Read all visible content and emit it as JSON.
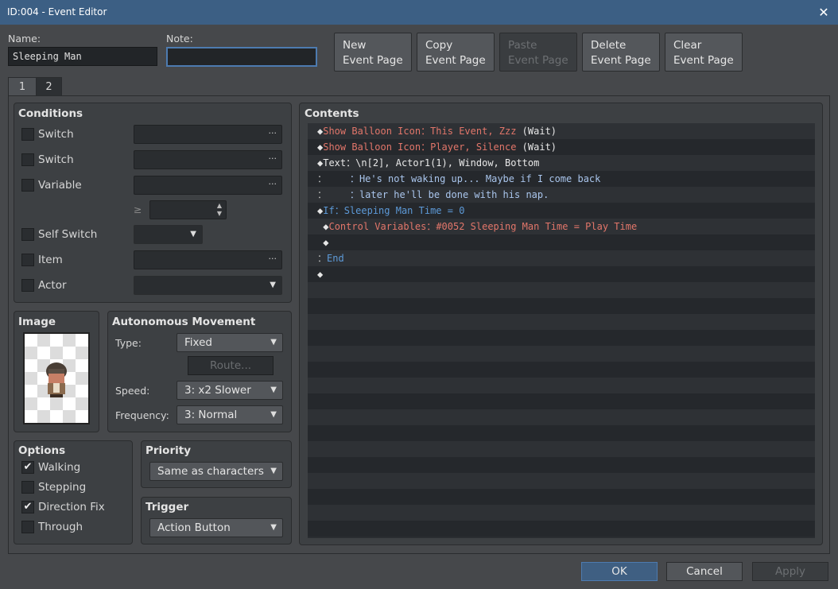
{
  "window": {
    "title": "ID:004 - Event Editor",
    "close": "✕"
  },
  "name": {
    "label": "Name:",
    "value": "Sleeping Man"
  },
  "note": {
    "label": "Note:",
    "value": ""
  },
  "page_buttons": [
    {
      "l1": "New",
      "l2": "Event Page"
    },
    {
      "l1": "Copy",
      "l2": "Event Page"
    },
    {
      "l1": "Paste",
      "l2": "Event Page"
    },
    {
      "l1": "Delete",
      "l2": "Event Page"
    },
    {
      "l1": "Clear",
      "l2": "Event Page"
    }
  ],
  "tabs": [
    "1",
    "2"
  ],
  "conditions": {
    "title": "Conditions",
    "switch1": "Switch",
    "switch2": "Switch",
    "variable": "Variable",
    "gte": "≥",
    "self_switch": "Self Switch",
    "item": "Item",
    "actor": "Actor",
    "dots": "···"
  },
  "image": {
    "title": "Image"
  },
  "movement": {
    "title": "Autonomous Movement",
    "type_label": "Type:",
    "type": "Fixed",
    "route": "Route...",
    "speed_label": "Speed:",
    "speed": "3: x2 Slower",
    "freq_label": "Frequency:",
    "freq": "3: Normal"
  },
  "options": {
    "title": "Options",
    "items": [
      {
        "label": "Walking",
        "checked": true
      },
      {
        "label": "Stepping",
        "checked": false
      },
      {
        "label": "Direction Fix",
        "checked": true
      },
      {
        "label": "Through",
        "checked": false
      }
    ]
  },
  "priority": {
    "title": "Priority",
    "value": "Same as characters"
  },
  "trigger": {
    "title": "Trigger",
    "value": "Action Button"
  },
  "contents": {
    "title": "Contents",
    "rows": [
      {
        "ind": "",
        "p": "◆",
        "cmd": "Show Balloon Icon",
        "sep": "：",
        "arg": "This Event, Zzz",
        "extra": " (Wait)",
        "c": "red"
      },
      {
        "ind": "",
        "p": "◆",
        "cmd": "Show Balloon Icon",
        "sep": "：",
        "arg": "Player, Silence",
        "extra": " (Wait)",
        "c": "red"
      },
      {
        "ind": "",
        "p": "◆",
        "cmd": "Text",
        "sep": "：",
        "arg": "\\n[2], Actor1(1), Window, Bottom",
        "extra": "",
        "c": "white"
      },
      {
        "ind": "",
        "p": "：",
        "cmd": "    ",
        "sep": "：",
        "arg": "He's not waking up... Maybe if I come back",
        "extra": "",
        "c": "lblue"
      },
      {
        "ind": "",
        "p": "：",
        "cmd": "    ",
        "sep": "：",
        "arg": "later he'll be done with his nap.",
        "extra": "",
        "c": "lblue"
      },
      {
        "ind": "",
        "p": "◆",
        "cmd": "If",
        "sep": "：",
        "arg": "Sleeping Man Time = 0",
        "extra": "",
        "c": "blue"
      },
      {
        "ind": " ",
        "p": "◆",
        "cmd": "Control Variables",
        "sep": "：",
        "arg": "#0052 Sleeping Man Time = Play Time",
        "extra": "",
        "c": "red"
      },
      {
        "ind": " ",
        "p": "◆",
        "cmd": "",
        "sep": "",
        "arg": "",
        "extra": "",
        "c": "white"
      },
      {
        "ind": "",
        "p": "：",
        "cmd": "End",
        "sep": "",
        "arg": "",
        "extra": "",
        "c": "blue"
      },
      {
        "ind": "",
        "p": "◆",
        "cmd": "",
        "sep": "",
        "arg": "",
        "extra": "",
        "c": "white"
      }
    ]
  },
  "footer": {
    "ok": "OK",
    "cancel": "Cancel",
    "apply": "Apply"
  }
}
